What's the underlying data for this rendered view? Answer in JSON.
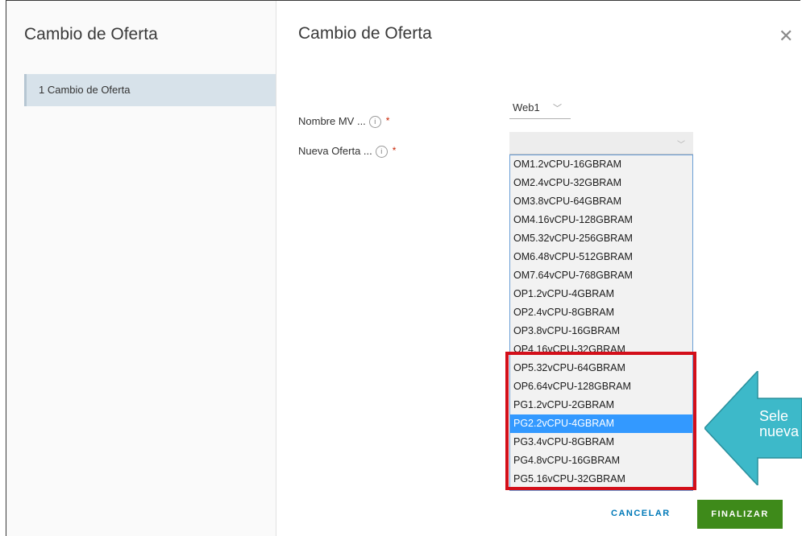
{
  "sidebar": {
    "title": "Cambio de Oferta",
    "steps": [
      {
        "label": "1 Cambio de Oferta"
      }
    ]
  },
  "dialog": {
    "title": "Cambio de Oferta",
    "close_icon": "close-icon"
  },
  "form": {
    "vm_name": {
      "label": "Nombre MV ...",
      "value": "Web1",
      "required_marker": "*"
    },
    "new_offer": {
      "label": "Nueva Oferta ...",
      "required_marker": "*",
      "selected": "PG2.2vCPU-4GBRAM"
    },
    "options": [
      "OM1.2vCPU-16GBRAM",
      "OM2.4vCPU-32GBRAM",
      "OM3.8vCPU-64GBRAM",
      "OM4.16vCPU-128GBRAM",
      "OM5.32vCPU-256GBRAM",
      "OM6.48vCPU-512GBRAM",
      "OM7.64vCPU-768GBRAM",
      "OP1.2vCPU-4GBRAM",
      "OP2.4vCPU-8GBRAM",
      "OP3.8vCPU-16GBRAM",
      "OP4.16vCPU-32GBRAM",
      "OP5.32vCPU-64GBRAM",
      "OP6.64vCPU-128GBRAM",
      "PG1.2vCPU-2GBRAM",
      "PG2.2vCPU-4GBRAM",
      "PG3.4vCPU-8GBRAM",
      "PG4.8vCPU-16GBRAM",
      "PG5.16vCPU-32GBRAM"
    ]
  },
  "annotation": {
    "line1": "Sele",
    "line2": "nueva",
    "arrow_color": "#3db9c9",
    "highlight_color": "#d30f1a"
  },
  "footer": {
    "cancel_label": "CANCELAR",
    "finish_label": "FINALIZAR"
  }
}
